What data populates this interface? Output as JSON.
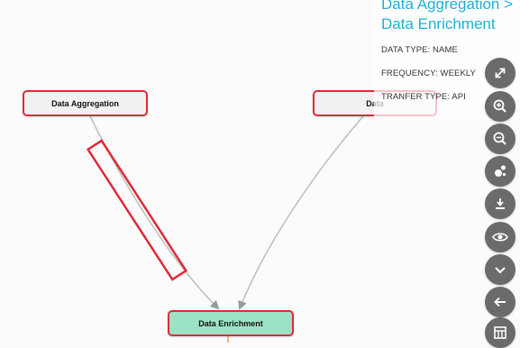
{
  "nodes": {
    "aggregation": "Data Aggregation",
    "data_source": "Data",
    "enrichment": "Data Enrichment"
  },
  "info": {
    "title": "Data Aggregation > Data Enrichment",
    "data_type": "DATA TYPE: NAME",
    "frequency": "FREQUENCY: WEEKLY",
    "transfer_type": "TRANFER TYPE: API"
  },
  "toolbar": {
    "icons": [
      "expand-icon",
      "zoom-in-icon",
      "zoom-out-icon",
      "cluster-icon",
      "download-icon",
      "eye-icon",
      "chevron-down-icon",
      "arrow-left-icon",
      "table-icon"
    ]
  },
  "colors": {
    "node_border": "#e02a3b",
    "node_fill": "#f1f1f1",
    "target_node_fill": "#9ce3c5",
    "title_accent": "#1db0d4",
    "toolbar_button": "#6b6b6b",
    "edge": "#bbbbbb"
  }
}
